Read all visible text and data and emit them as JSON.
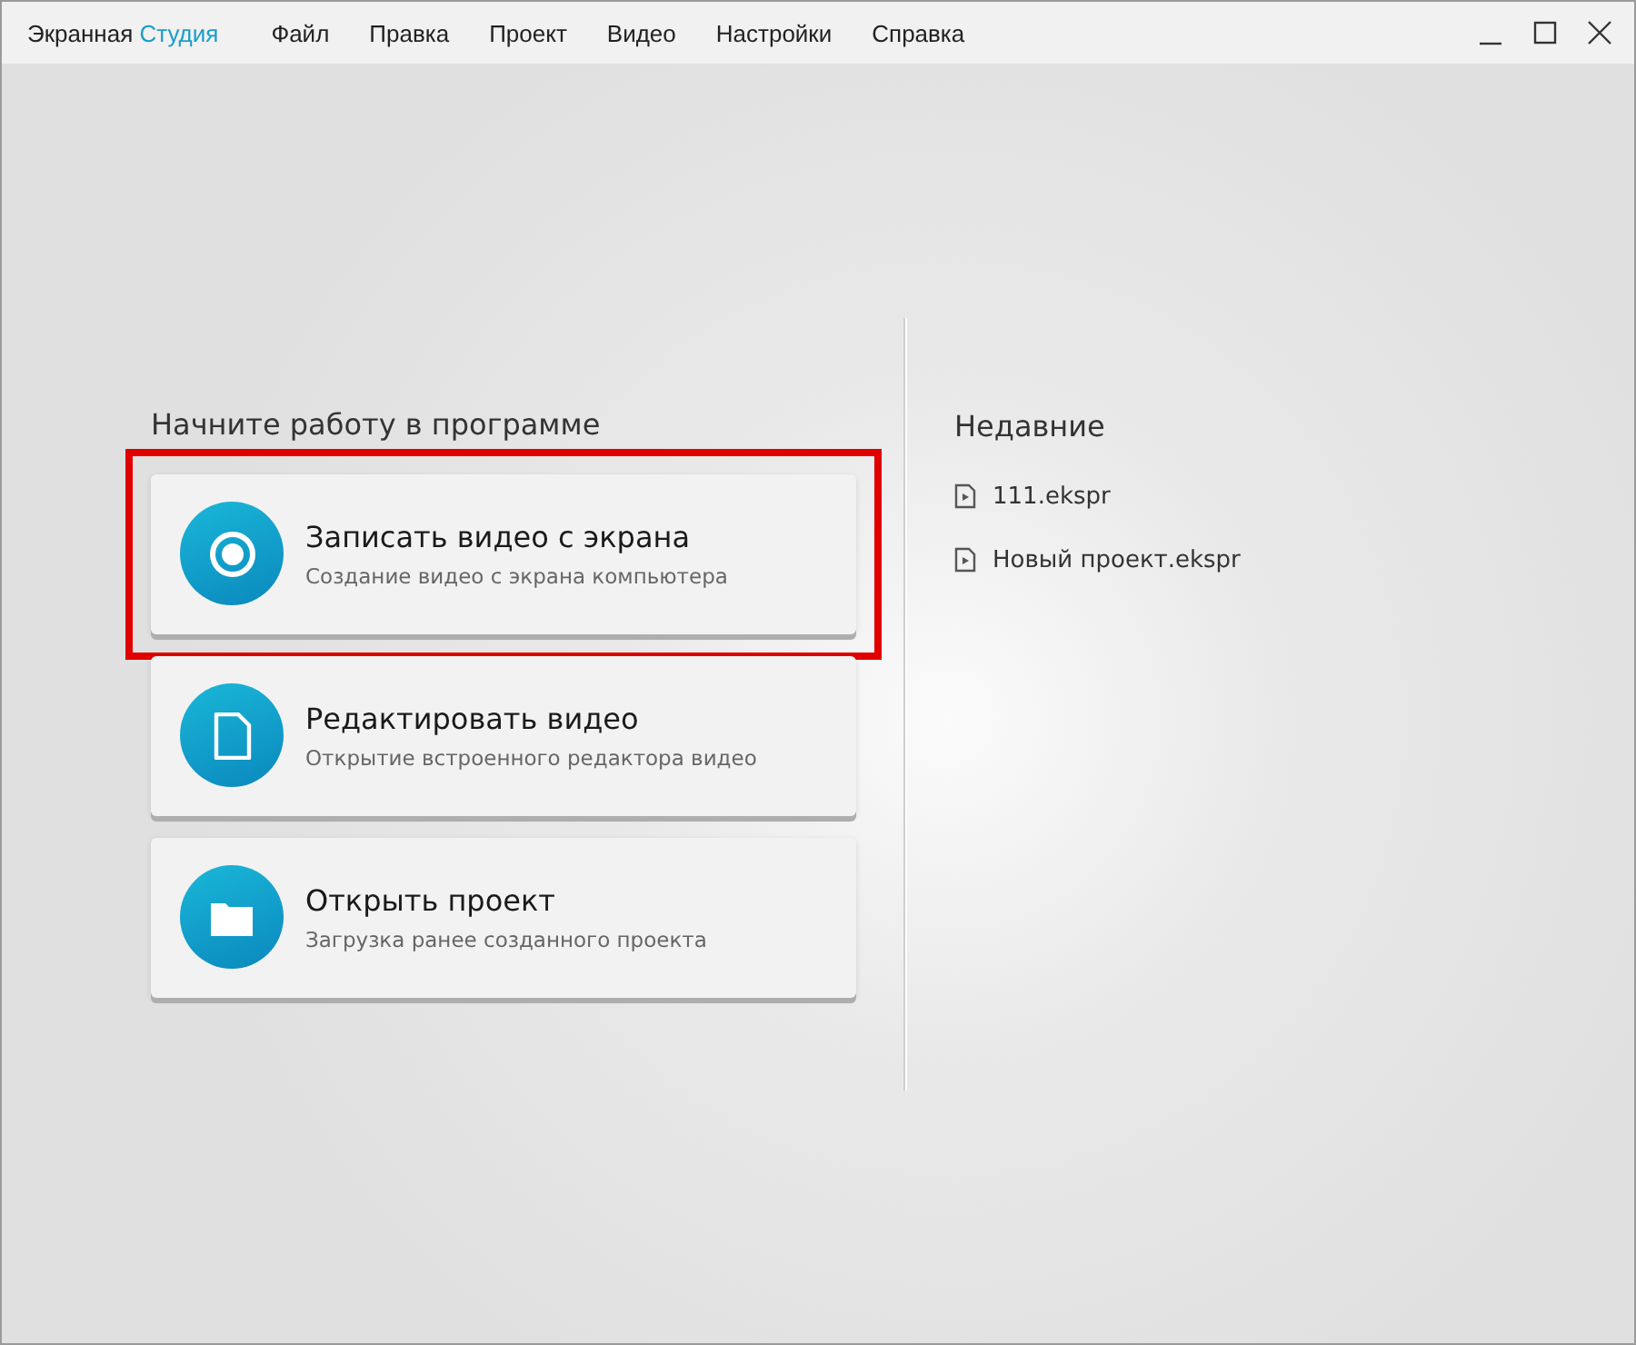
{
  "app_title": {
    "name": "Экранная",
    "accent": "Студия"
  },
  "menu": [
    "Файл",
    "Правка",
    "Проект",
    "Видео",
    "Настройки",
    "Справка"
  ],
  "window_controls": [
    {
      "kind": "minimize"
    },
    {
      "kind": "maximize"
    },
    {
      "kind": "close"
    }
  ],
  "start": {
    "heading": "Начните работу в программе",
    "actions": [
      {
        "kind": "record",
        "title": "Записать видео с экрана",
        "subtitle": "Создание видео с экрана компьютера",
        "highlighted": true
      },
      {
        "kind": "edit",
        "title": "Редактировать видео",
        "subtitle": "Открытие встроенного редактора видео",
        "highlighted": false
      },
      {
        "kind": "open",
        "title": "Открыть проект",
        "subtitle": "Загрузка ранее созданного проекта",
        "highlighted": false
      }
    ]
  },
  "recent": {
    "heading": "Недавние",
    "files": [
      "111.ekspr",
      "Новый проект.ekspr"
    ]
  }
}
